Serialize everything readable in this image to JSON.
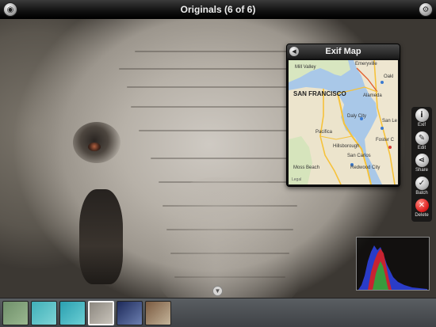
{
  "topbar": {
    "title": "Originals (6 of 6)",
    "left_icon": "camera-icon",
    "right_icon": "settings-icon"
  },
  "exif_map": {
    "title": "Exif Map",
    "back_icon": "back-icon",
    "labels": {
      "mill_valley": "Mill Valley",
      "emeryville": "Emeryville",
      "oakland": "Oakl",
      "san_francisco": "SAN FRANCISCO",
      "alameda": "Alameda",
      "daly_city": "Daly City",
      "san_leandro": "San Le",
      "pacifica": "Pacifica",
      "foster_city": "Foster C",
      "hillsborough": "Hillsborough",
      "san_carlos": "San Carlos",
      "moss_beach": "Moss Beach",
      "redwood_city": "Redwood City",
      "legal": "Legal"
    }
  },
  "side_tools": [
    {
      "label": "Exif",
      "icon": "info-icon",
      "glyph": "i"
    },
    {
      "label": "Edit",
      "icon": "edit-icon",
      "glyph": "✎"
    },
    {
      "label": "Share",
      "icon": "share-icon",
      "glyph": "⋖"
    },
    {
      "label": "Batch",
      "icon": "checkmark-icon",
      "glyph": "✓"
    },
    {
      "label": "Delete",
      "icon": "delete-icon",
      "glyph": "✕"
    }
  ],
  "filmstrip": {
    "selected_index": 3,
    "thumbnails": [
      {
        "colors": [
          "#6f8f6a",
          "#9ab890"
        ]
      },
      {
        "colors": [
          "#3fb0b8",
          "#7fd4d6"
        ]
      },
      {
        "colors": [
          "#2a9fb0",
          "#6ccfd4"
        ]
      },
      {
        "colors": [
          "#8c877f",
          "#c9c4bb"
        ]
      },
      {
        "colors": [
          "#1d2a5a",
          "#6c7fb0"
        ]
      },
      {
        "colors": [
          "#7a5a40",
          "#c4b49a"
        ]
      }
    ]
  },
  "colors": {
    "accent_delete": "#e02020",
    "histogram_blue": "#2a3cc8",
    "histogram_red": "#d82020",
    "histogram_green": "#20b040"
  }
}
